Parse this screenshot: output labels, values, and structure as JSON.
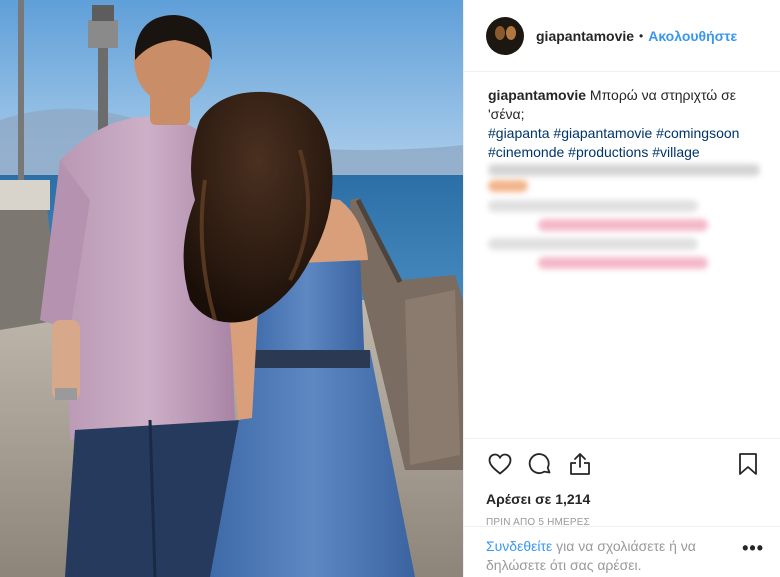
{
  "post": {
    "username": "giapantamovie",
    "separator": "•",
    "follow_label": "Ακολουθήστε",
    "caption": {
      "username": "giapantamovie",
      "text": "Μπορώ να στηριχτώ σε 'σένα;",
      "hashtags": [
        "#giapanta",
        "#giapantamovie",
        "#comingsoon",
        "#cinemonde",
        "#productions",
        "#village"
      ]
    },
    "icons": {
      "like": "heart-icon",
      "comment": "comment-icon",
      "share": "share-icon",
      "save": "bookmark-icon",
      "more": "more-options-icon"
    },
    "likes_text": "Αρέσει σε 1,214",
    "timestamp": "ΠΡΙΝ ΑΠΟ 5 ΗΜΕΡΕΣ",
    "comment_prompt": {
      "login_link": "Συνδεθείτε",
      "rest": " για να σχολιάσετε ή να δηλώσετε ότι σας αρέσει."
    },
    "more_label": "•••"
  },
  "colors": {
    "link_blue": "#3897f0",
    "hashtag_blue": "#003569",
    "text": "#262626",
    "muted": "#999999",
    "divider": "#efefef"
  }
}
